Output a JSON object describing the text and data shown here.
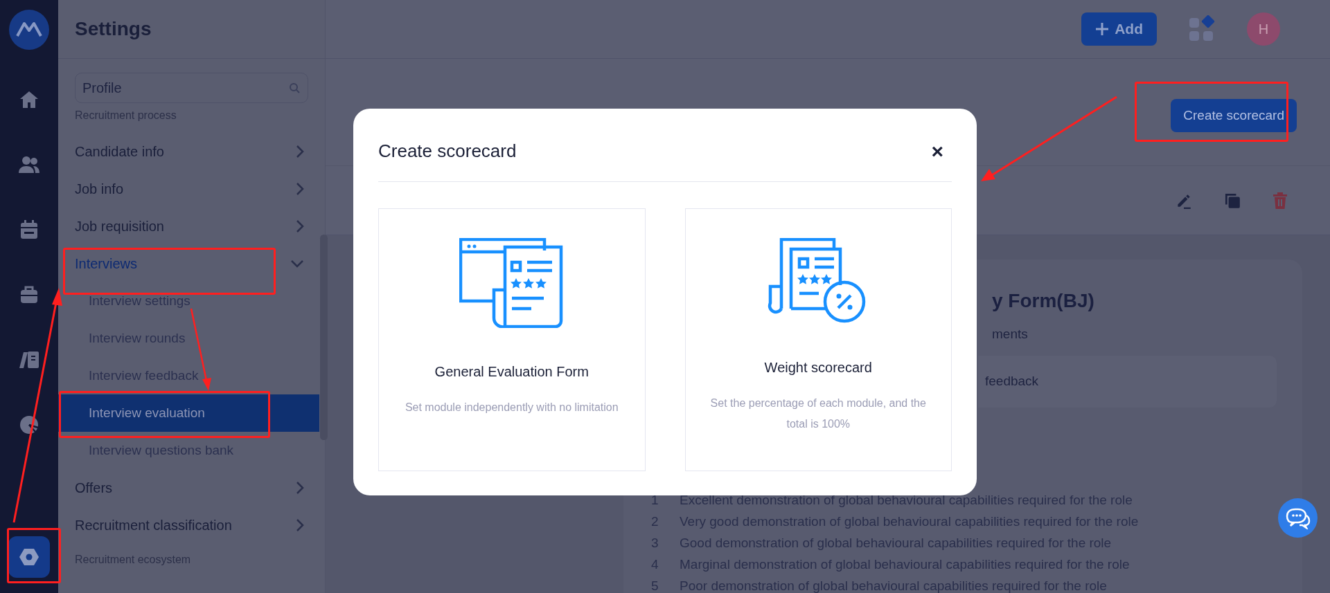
{
  "rail": [
    {
      "kind": "home",
      "selected": false
    },
    {
      "kind": "people",
      "selected": false
    },
    {
      "kind": "calendar",
      "selected": false
    },
    {
      "kind": "briefcase",
      "selected": false
    },
    {
      "kind": "cards",
      "selected": false
    },
    {
      "kind": "chart",
      "selected": false
    },
    {
      "kind": "settings",
      "selected": true
    }
  ],
  "header": {
    "title": "Settings",
    "add_button": "Add",
    "avatar": "H"
  },
  "sidebar": {
    "search": {
      "value": "Profile"
    },
    "sections": [
      {
        "label": "Recruitment process",
        "items": [
          {
            "label": "Candidate info",
            "expanded": false
          },
          {
            "label": "Job info",
            "expanded": false
          },
          {
            "label": "Job requisition",
            "expanded": false
          },
          {
            "label": "Interviews",
            "expanded": true,
            "children": [
              {
                "label": "Interview settings",
                "selected": false
              },
              {
                "label": "Interview rounds",
                "selected": false
              },
              {
                "label": "Interview feedback",
                "selected": false
              },
              {
                "label": "Interview evaluation",
                "selected": true
              },
              {
                "label": "Interview questions bank",
                "selected": false
              }
            ]
          },
          {
            "label": "Offers",
            "expanded": false
          },
          {
            "label": "Recruitment classification",
            "expanded": false
          }
        ]
      },
      {
        "label": "Recruitment ecosystem"
      }
    ]
  },
  "page": {
    "create_button": "Create scorecard",
    "form_card": {
      "title": "y Form(BJ)",
      "subtitle": "ments",
      "field": "feedback",
      "ratings": [
        {
          "number": "1",
          "text": "Excellent demonstration of global behavioural capabilities required for the role"
        },
        {
          "number": "2",
          "text": "Very good demonstration of global behavioural capabilities required for the role"
        },
        {
          "number": "3",
          "text": "Good demonstration of global behavioural capabilities required for the role"
        },
        {
          "number": "4",
          "text": "Marginal demonstration of global behavioural capabilities required for the role"
        },
        {
          "number": "5",
          "text": "Poor demonstration of global behavioural capabilities required for the role"
        }
      ]
    }
  },
  "modal": {
    "title": "Create scorecard",
    "close": "×",
    "options": [
      {
        "kind": "general",
        "title": "General Evaluation Form",
        "description": "Set module independently with no limitation"
      },
      {
        "kind": "weight",
        "title": "Weight scorecard",
        "description": "Set the percentage of each module, and the total is 100%"
      }
    ]
  }
}
